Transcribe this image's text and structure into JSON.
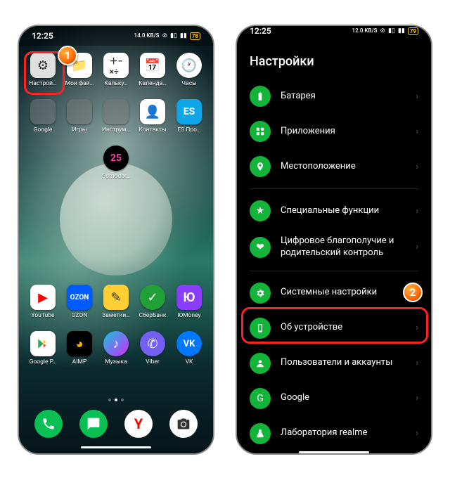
{
  "status": {
    "time": "12:25",
    "speed": "14.0 KB/S",
    "battery1": "78",
    "battery2": "79"
  },
  "home": {
    "apps_row1": [
      {
        "label": "Настрой…",
        "icon": "settings"
      },
      {
        "label": "Мои фай…",
        "icon": "files"
      },
      {
        "label": "Кальку…",
        "icon": "calc"
      },
      {
        "label": "Календа…",
        "icon": "cal"
      },
      {
        "label": "Часы",
        "icon": "clock"
      }
    ],
    "apps_row2": [
      {
        "label": "Google",
        "icon": "folder"
      },
      {
        "label": "Игры",
        "icon": "folder"
      },
      {
        "label": "Инструм…",
        "icon": "folder"
      },
      {
        "label": "Контакты",
        "icon": "contacts"
      },
      {
        "label": "ES Про…",
        "icon": "es"
      }
    ],
    "apps_row3": [
      {
        "label": "Pomodor…",
        "icon": "pomodoro"
      }
    ],
    "apps_row4": [
      {
        "label": "YouTube",
        "icon": "youtube"
      },
      {
        "label": "OZON",
        "icon": "ozon"
      },
      {
        "label": "Заметки…",
        "icon": "notes"
      },
      {
        "label": "СберБанк",
        "icon": "sber"
      },
      {
        "label": "ЮMoney",
        "icon": "umoney"
      }
    ],
    "apps_row5": [
      {
        "label": "Google P…",
        "icon": "play"
      },
      {
        "label": "AIMP",
        "icon": "aimp"
      },
      {
        "label": "Музыка",
        "icon": "music"
      },
      {
        "label": "Viber",
        "icon": "viber"
      },
      {
        "label": "VK",
        "icon": "vk"
      }
    ]
  },
  "settings": {
    "title": "Настройки",
    "items": [
      {
        "label": "Батарея",
        "icon": "battery"
      },
      {
        "label": "Приложения",
        "icon": "apps"
      },
      {
        "label": "Местоположение",
        "icon": "location"
      },
      {
        "label": "Специальные функции",
        "icon": "special"
      },
      {
        "label": "Цифровое благополучие и родительский контроль",
        "icon": "wellbeing"
      },
      {
        "label": "Системные настройки",
        "icon": "system"
      },
      {
        "label": "Об устройстве",
        "icon": "about"
      },
      {
        "label": "Пользователи и аккаунты",
        "icon": "users"
      },
      {
        "label": "Google",
        "icon": "google"
      },
      {
        "label": "Лаборатория realme",
        "icon": "lab"
      }
    ]
  },
  "glyphs": {
    "es": "ES",
    "pomodoro": "25",
    "ozon": "OZON",
    "vk": "VK",
    "umoney": "Ю",
    "step1": "1",
    "step2": "2"
  }
}
